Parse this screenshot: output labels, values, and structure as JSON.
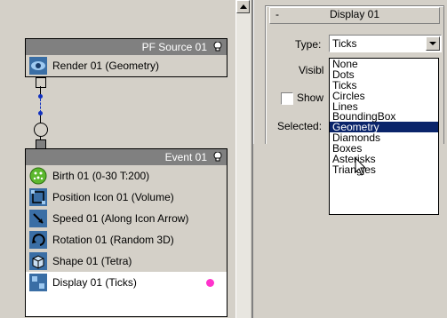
{
  "nodes": {
    "source": {
      "title": "PF Source 01",
      "operators": [
        {
          "label": "Render 01 (Geometry)",
          "icon": "render-icon"
        }
      ]
    },
    "event": {
      "title": "Event 01",
      "operators": [
        {
          "label": "Birth 01 (0-30 T:200)",
          "icon": "birth-icon"
        },
        {
          "label": "Position Icon 01 (Volume)",
          "icon": "position-icon"
        },
        {
          "label": "Speed 01 (Along Icon Arrow)",
          "icon": "speed-icon"
        },
        {
          "label": "Rotation 01 (Random 3D)",
          "icon": "rotation-icon"
        },
        {
          "label": "Shape 01 (Tetra)",
          "icon": "shape-icon"
        },
        {
          "label": "Display 01 (Ticks)",
          "icon": "display-icon"
        }
      ]
    }
  },
  "panel": {
    "minus": "-",
    "title": "Display 01",
    "type_label": "Type:",
    "type_value": "Ticks",
    "visible_label": "Visibl",
    "show_label": "Show",
    "selected_label": "Selected:"
  },
  "dropdown": {
    "items": [
      "None",
      "Dots",
      "Ticks",
      "Circles",
      "Lines",
      "BoundingBox",
      "Geometry",
      "Diamonds",
      "Boxes",
      "Asterisks",
      "Triangles"
    ],
    "highlighted": "Geometry"
  },
  "colors": {
    "highlight": "#0a246a",
    "node_header": "#808080",
    "display_dot": "#ff33cc"
  }
}
